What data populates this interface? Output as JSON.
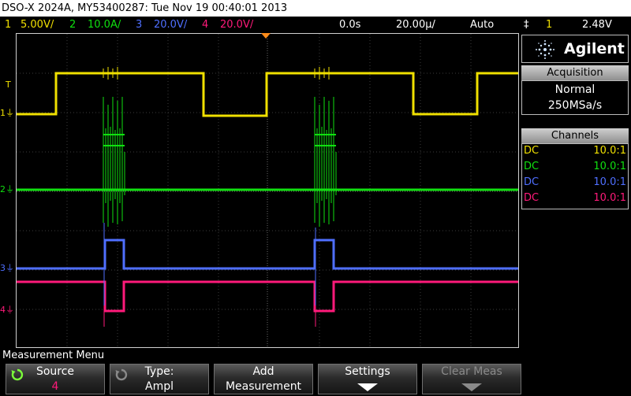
{
  "title_bar": {
    "text": "DSO-X 2024A, MY53400287: Tue Nov 19 00:40:01 2013"
  },
  "channels": [
    {
      "num": "1",
      "scale": "5.00V/",
      "color": "#f0e000"
    },
    {
      "num": "2",
      "scale": "10.0A/",
      "color": "#10e010"
    },
    {
      "num": "3",
      "scale": "20.0V/",
      "color": "#4f6fff"
    },
    {
      "num": "4",
      "scale": "20.0V/",
      "color": "#ff1a7a"
    }
  ],
  "timebase": {
    "delay": "0.0s",
    "scale": "20.00µ/"
  },
  "trigger": {
    "mode": "Auto",
    "source": "1",
    "level": "2.48V",
    "slope_symbol": "‡"
  },
  "markers": {
    "trigger_level": "T",
    "ch1": "1",
    "ch2": "2",
    "ch3": "3",
    "ch4": "4"
  },
  "brand": {
    "name": "Agilent"
  },
  "acquisition": {
    "header": "Acquisition",
    "mode": "Normal",
    "rate": "250MSa/s"
  },
  "channels_panel": {
    "header": "Channels",
    "rows": [
      {
        "coupling": "DC",
        "probe": "10.0:1"
      },
      {
        "coupling": "DC",
        "probe": "10.0:1"
      },
      {
        "coupling": "DC",
        "probe": "10.0:1"
      },
      {
        "coupling": "DC",
        "probe": "10.0:1"
      }
    ]
  },
  "menu": {
    "title": "Measurement Menu"
  },
  "softkeys": {
    "source": {
      "line1": "Source",
      "line2": "4"
    },
    "type": {
      "line1": "Type:",
      "line2": "Ampl"
    },
    "add": {
      "line1": "Add",
      "line2": "Measurement"
    },
    "settings": {
      "line1": "Settings"
    },
    "clear": {
      "line1": "Clear Meas"
    }
  }
}
